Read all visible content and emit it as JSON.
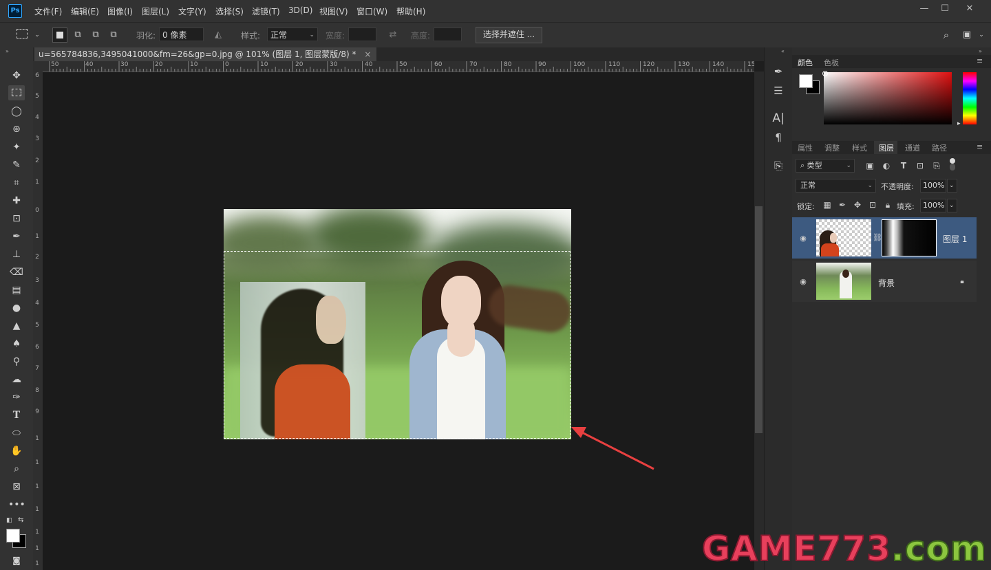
{
  "menu": {
    "logo": "Ps",
    "items": [
      "文件(F)",
      "编辑(E)",
      "图像(I)",
      "图层(L)",
      "文字(Y)",
      "选择(S)",
      "滤镜(T)",
      "3D(D)",
      "视图(V)",
      "窗口(W)",
      "帮助(H)"
    ],
    "window_controls": {
      "minimize": "—",
      "maximize": "☐",
      "close": "✕"
    }
  },
  "options": {
    "feather_label": "羽化:",
    "feather_value": "0 像素",
    "style_label": "样式:",
    "style_value": "正常",
    "width_label": "宽度:",
    "height_label": "高度:",
    "select_mask_button": "选择并遮住 ..."
  },
  "document": {
    "tab_title": "u=565784836,3495041000&fm=26&gp=0.jpg @ 101% (图层 1, 图层蒙版/8) *",
    "tab_close": "×"
  },
  "rulers": {
    "h_labels": [
      "50",
      "40",
      "30",
      "20",
      "10",
      "0",
      "10",
      "20",
      "30",
      "40",
      "50",
      "60",
      "70",
      "80",
      "90",
      "100",
      "110",
      "120",
      "130",
      "140",
      "15"
    ],
    "v_labels": [
      "6",
      "5",
      "4",
      "3",
      "2",
      "1",
      "0",
      "1",
      "2",
      "3",
      "4",
      "5",
      "6",
      "7",
      "8",
      "9",
      "1",
      "1",
      "1",
      "1",
      "1",
      "1",
      "1"
    ]
  },
  "color_panel": {
    "tabs": [
      "颜色",
      "色板"
    ],
    "active_tab": "颜色"
  },
  "layers_panel": {
    "tabs": [
      "属性",
      "调整",
      "样式",
      "图层",
      "通道",
      "路径"
    ],
    "active_tab": "图层",
    "filter_kind": "类型",
    "blend_mode": "正常",
    "opacity_label": "不透明度:",
    "opacity_value": "100%",
    "lock_label": "锁定:",
    "fill_label": "填充:",
    "fill_value": "100%",
    "layers": [
      {
        "name": "图层 1",
        "selected": true,
        "has_mask": true
      },
      {
        "name": "背景",
        "selected": false,
        "locked": true
      }
    ]
  },
  "watermark": {
    "text_a": "GAME773",
    "text_b": ".com",
    "color_a": "#e8405c",
    "color_b": "#8cc63f"
  },
  "colors": {
    "accent_selected_layer": "#3d5a80",
    "arrow": "#e84040"
  }
}
